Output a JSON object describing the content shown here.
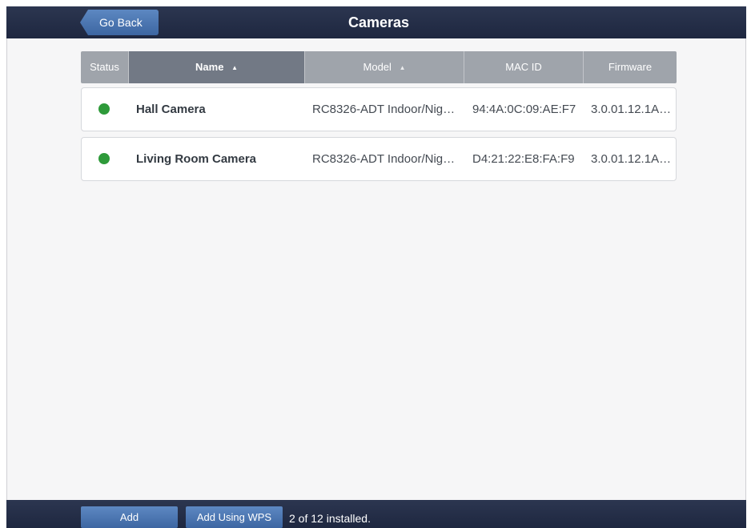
{
  "header": {
    "title": "Cameras",
    "back_label": "Go Back"
  },
  "table": {
    "columns": [
      {
        "key": "status",
        "label": "Status",
        "sortable": false,
        "active": false
      },
      {
        "key": "name",
        "label": "Name",
        "sortable": true,
        "active": true
      },
      {
        "key": "model",
        "label": "Model",
        "sortable": true,
        "active": false
      },
      {
        "key": "mac",
        "label": "MAC ID",
        "sortable": false,
        "active": false
      },
      {
        "key": "firmware",
        "label": "Firmware",
        "sortable": false,
        "active": false
      }
    ],
    "rows": [
      {
        "status": "online",
        "name": "Hall Camera",
        "model": "RC8326-ADT Indoor/Nig…",
        "mac": "94:4A:0C:09:AE:F7",
        "firmware": "3.0.01.12.1A…"
      },
      {
        "status": "online",
        "name": "Living Room Camera",
        "model": "RC8326-ADT Indoor/Nig…",
        "mac": "D4:21:22:E8:FA:F9",
        "firmware": "3.0.01.12.1A…"
      }
    ]
  },
  "footer": {
    "add_label": "Add",
    "add_wps_label": "Add Using WPS",
    "install_count": "2 of 12 installed."
  },
  "icons": {
    "sort": "sort-arrows-icon",
    "status_online": "status-online-icon"
  },
  "colors": {
    "header_bg": "#1e2740",
    "accent_button": "#4a76b4",
    "status_online": "#2e9a3a",
    "column_active": "#727985",
    "column_inactive": "#9fa4ab"
  }
}
